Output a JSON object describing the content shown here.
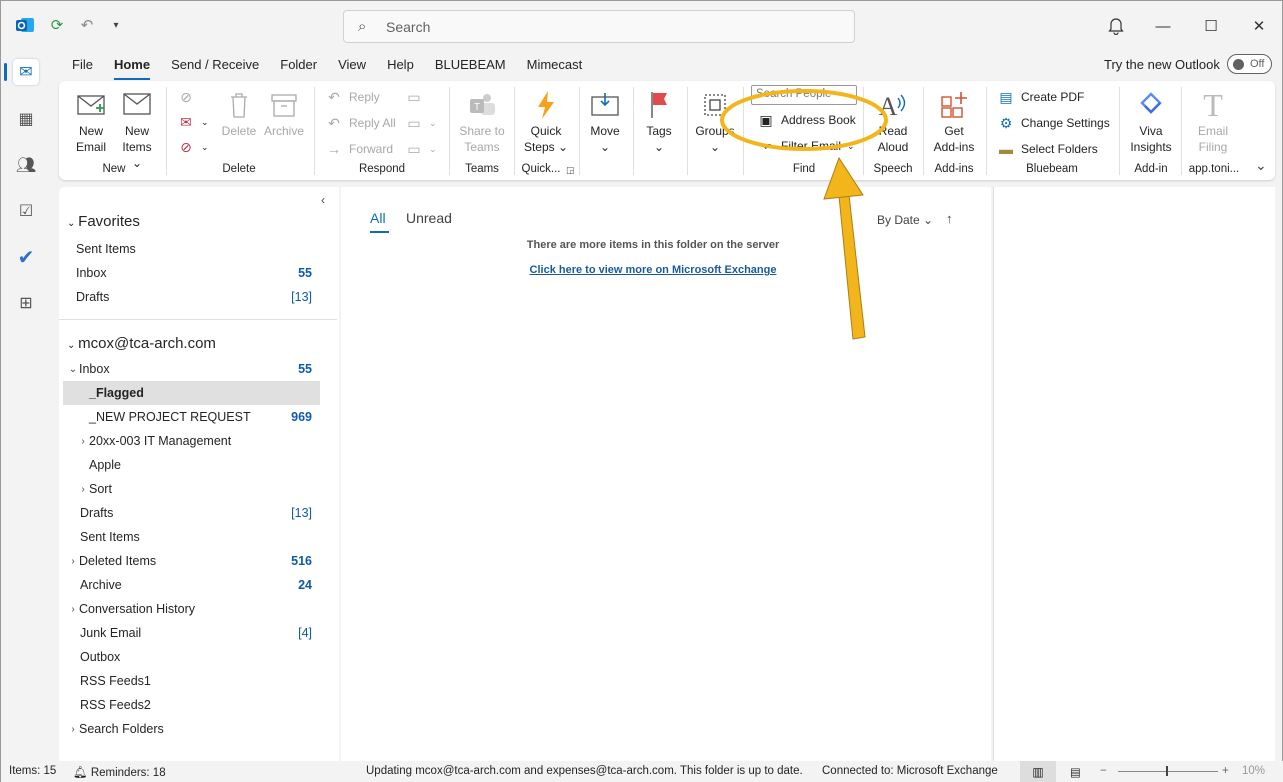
{
  "title_bar": {
    "search_placeholder": "Search",
    "outlook_icon": "outlook-logo-icon"
  },
  "menu": {
    "tabs": [
      "File",
      "Home",
      "Send / Receive",
      "Folder",
      "View",
      "Help",
      "BLUEBEAM",
      "Mimecast"
    ],
    "active": "Home",
    "try_new": "Try the new Outlook",
    "toggle": "Off"
  },
  "ribbon": {
    "new": {
      "new_email": [
        "New",
        "Email"
      ],
      "new_items": [
        "New",
        "Items"
      ],
      "label": "New"
    },
    "delete": {
      "delete": "Delete",
      "archive": "Archive",
      "label": "Delete"
    },
    "respond": {
      "reply": "Reply",
      "reply_all": "Reply All",
      "forward": "Forward",
      "label": "Respond"
    },
    "teams": {
      "share": [
        "Share to",
        "Teams"
      ],
      "label": "Teams"
    },
    "quick": {
      "quick_steps": [
        "Quick",
        "Steps"
      ],
      "label": "Quick..."
    },
    "move": {
      "move": "Move",
      "label": ""
    },
    "tags": {
      "tags": "Tags"
    },
    "groups": {
      "groups": "Groups"
    },
    "find": {
      "search_people": "Search People",
      "address_book": "Address Book",
      "filter_email": "Filter Email",
      "label": "Find"
    },
    "speech": {
      "read_aloud": [
        "Read",
        "Aloud"
      ],
      "label": "Speech"
    },
    "addins": {
      "get": [
        "Get",
        "Add-ins"
      ],
      "label": "Add-ins"
    },
    "bluebeam": {
      "create_pdf": "Create PDF",
      "change_settings": "Change Settings",
      "select_folders": "Select Folders",
      "label": "Bluebeam"
    },
    "addin": {
      "viva": [
        "Viva",
        "Insights"
      ],
      "label": "Add-in"
    },
    "email_filing": {
      "btn": [
        "Email",
        "Filing"
      ],
      "label": "app.toni..."
    }
  },
  "folders": {
    "favorites_header": "Favorites",
    "favorites": [
      {
        "name": "Sent Items",
        "count": ""
      },
      {
        "name": "Inbox",
        "count": "55"
      },
      {
        "name": "Drafts",
        "count": "[13]"
      }
    ],
    "account": "mcox@tca-arch.com",
    "items": [
      {
        "name": "Inbox",
        "count": "55"
      },
      {
        "name": "_Flagged",
        "count": ""
      },
      {
        "name": "_NEW PROJECT REQUEST",
        "count": "969"
      },
      {
        "name": "20xx-003 IT Management",
        "count": ""
      },
      {
        "name": "Apple",
        "count": ""
      },
      {
        "name": "Sort",
        "count": ""
      },
      {
        "name": "Drafts",
        "count": "[13]"
      },
      {
        "name": "Sent Items",
        "count": ""
      },
      {
        "name": "Deleted Items",
        "count": "516"
      },
      {
        "name": "Archive",
        "count": "24"
      },
      {
        "name": "Conversation History",
        "count": ""
      },
      {
        "name": "Junk Email",
        "count": "[4]"
      },
      {
        "name": "Outbox",
        "count": ""
      },
      {
        "name": "RSS Feeds1",
        "count": ""
      },
      {
        "name": "RSS Feeds2",
        "count": ""
      },
      {
        "name": "Search Folders",
        "count": ""
      }
    ]
  },
  "message_list": {
    "tab_all": "All",
    "tab_unread": "Unread",
    "sort": "By Date",
    "notice": "There are more items in this folder on the server",
    "link": "Click here to view more on Microsoft Exchange"
  },
  "status": {
    "items": "Items: 15",
    "reminders": "Reminders: 18",
    "updating": "Updating mcox@tca-arch.com and expenses@tca-arch.com.  This folder is up to date.",
    "connected": "Connected to: Microsoft Exchange",
    "zoom": "10%"
  },
  "colors": {
    "accent": "#0f6cbd",
    "highlight": "#f2b51c"
  }
}
